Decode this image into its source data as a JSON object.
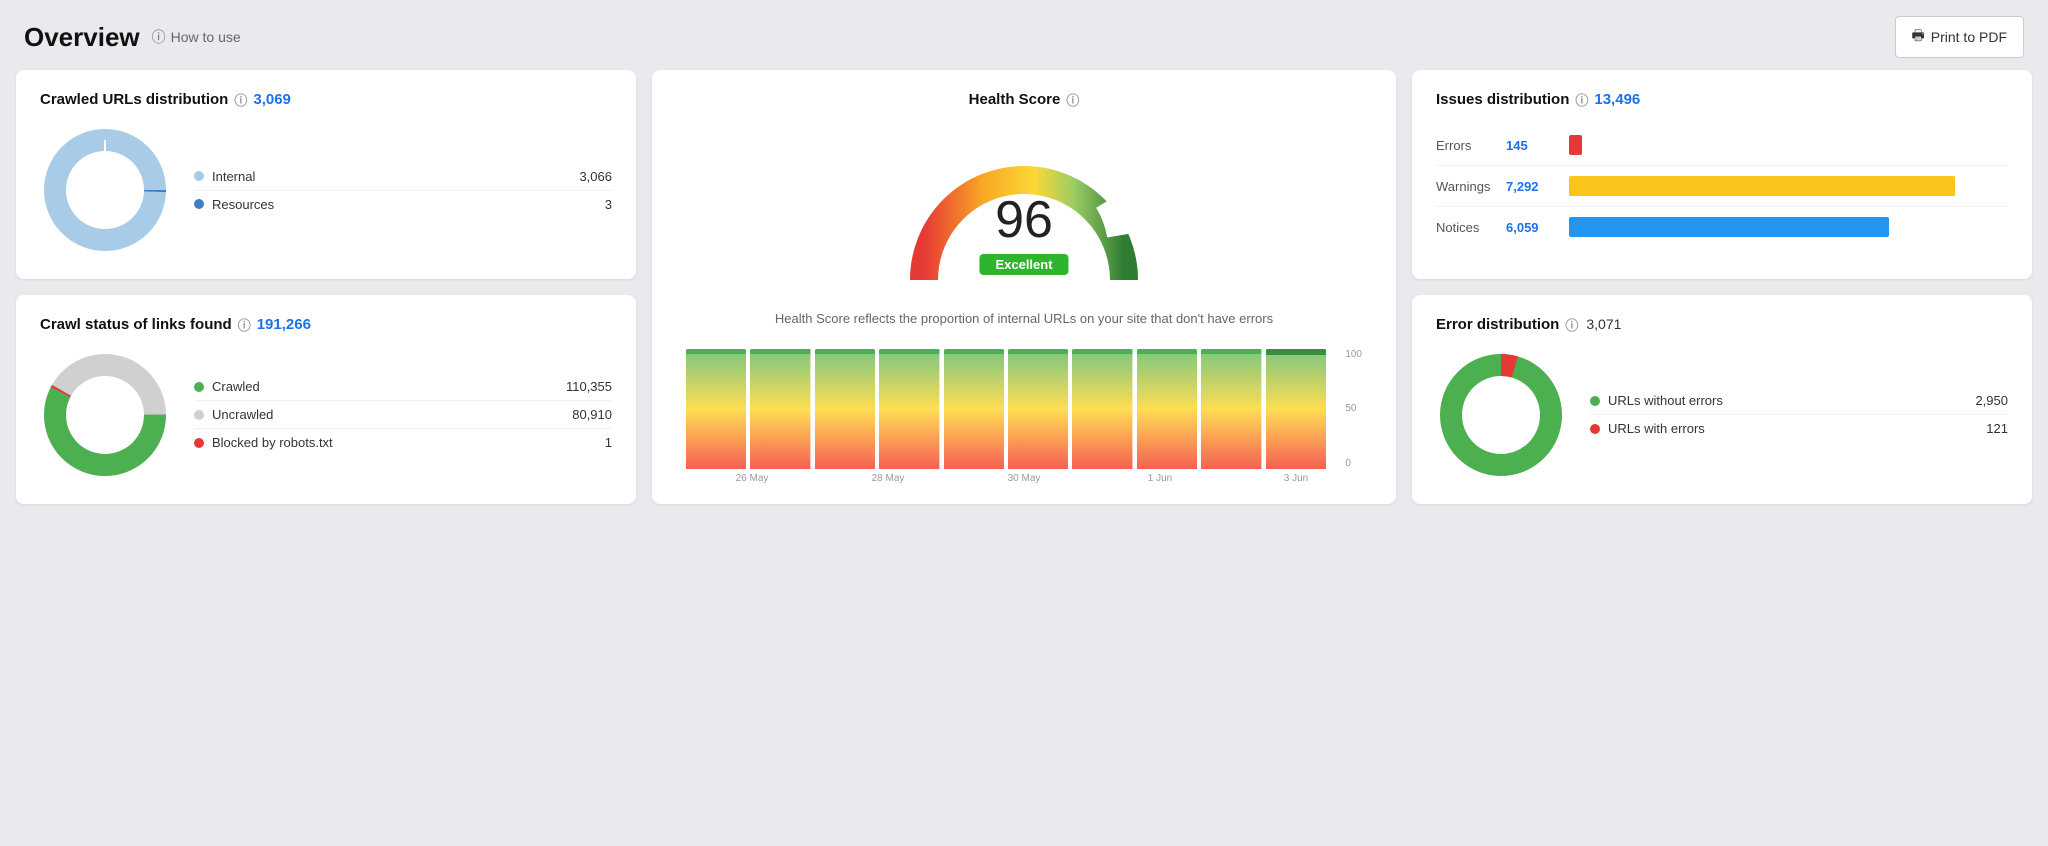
{
  "header": {
    "title": "Overview",
    "how_to_use": "How to use",
    "print_btn": "Print to PDF"
  },
  "crawled_urls": {
    "title": "Crawled URLs distribution",
    "count": "3,069",
    "legend": [
      {
        "label": "Internal",
        "value": "3,066",
        "color": "#a8cce8"
      },
      {
        "label": "Resources",
        "value": "3",
        "color": "#3b7fc4"
      }
    ]
  },
  "health_score": {
    "title": "Health Score",
    "score": "96",
    "badge": "Excellent",
    "description": "Health Score reflects the proportion of internal URLs on your site that don't have errors",
    "chart_labels": [
      "26 May",
      "28 May",
      "30 May",
      "1 Jun",
      "3 Jun"
    ],
    "y_labels": [
      "100",
      "50",
      "0"
    ]
  },
  "issues_distribution": {
    "title": "Issues distribution",
    "count": "13,496",
    "items": [
      {
        "label": "Errors",
        "value": "145",
        "color": "#e53935",
        "bar_width": "3"
      },
      {
        "label": "Warnings",
        "value": "7,292",
        "color": "#f9c51a",
        "bar_width": "88"
      },
      {
        "label": "Notices",
        "value": "6,059",
        "color": "#2196f3",
        "bar_width": "73"
      }
    ]
  },
  "crawl_status": {
    "title": "Crawl status of links found",
    "count": "191,266",
    "legend": [
      {
        "label": "Crawled",
        "value": "110,355",
        "color": "#4caf50"
      },
      {
        "label": "Uncrawled",
        "value": "80,910",
        "color": "#d0d0d0"
      },
      {
        "label": "Blocked by robots.txt",
        "value": "1",
        "color": "#e53935"
      }
    ]
  },
  "error_distribution": {
    "title": "Error distribution",
    "count": "3,071",
    "legend": [
      {
        "label": "URLs without errors",
        "value": "2,950",
        "color": "#4caf50"
      },
      {
        "label": "URLs with errors",
        "value": "121",
        "color": "#e53935"
      }
    ]
  }
}
